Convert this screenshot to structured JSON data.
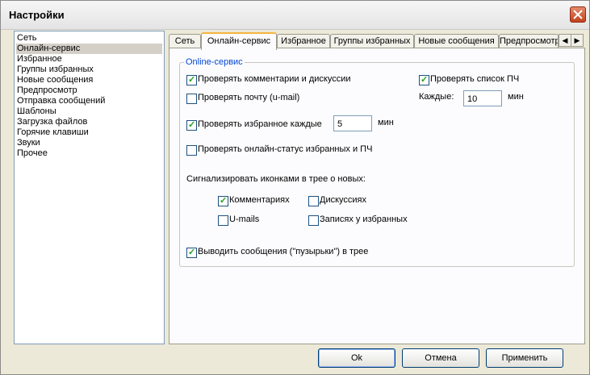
{
  "window": {
    "title": "Настройки"
  },
  "sidebar": {
    "items": [
      "Сеть",
      "Онлайн-сервис",
      "Избранное",
      "Группы избранных",
      "Новые сообщения",
      "Предпросмотр",
      "Отправка сообщений",
      "Шаблоны",
      "Загрузка файлов",
      "Горячие клавиши",
      "Звуки",
      "Прочее"
    ],
    "selected": "Онлайн-сервис"
  },
  "tabs": {
    "items": [
      "Сеть",
      "Онлайн-сервис",
      "Избранное",
      "Группы избранных",
      "Новые сообщения",
      "Предпросмотр"
    ],
    "active": "Онлайн-сервис"
  },
  "group": {
    "title": "Online-сервис"
  },
  "options": {
    "check_comments": {
      "label": "Проверять комментарии и дискуссии",
      "checked": true
    },
    "check_mail": {
      "label": "Проверять почту (u-mail)",
      "checked": false
    },
    "check_favorites": {
      "label": "Проверять избранное каждые",
      "checked": true,
      "value": "5",
      "unit": "мин"
    },
    "check_online_status": {
      "label": "Проверять онлайн-статус избранных и ПЧ",
      "checked": false
    },
    "check_pch": {
      "label": "Проверять список ПЧ",
      "checked": true
    },
    "every_label": "Каждые:",
    "every_value": "10",
    "every_unit": "мин"
  },
  "signal": {
    "heading": "Сигнализировать иконками в трее о новых:",
    "comments": {
      "label": "Комментариях",
      "checked": true
    },
    "discussions": {
      "label": "Дискуссиях",
      "checked": false
    },
    "umails": {
      "label": "U-mails",
      "checked": false
    },
    "fav_posts": {
      "label": "Записях у избранных",
      "checked": false
    }
  },
  "bubbles": {
    "label": "Выводить сообщения (\"пузырьки\") в трее",
    "checked": true
  },
  "buttons": {
    "ok": "Ok",
    "cancel": "Отмена",
    "apply": "Применить"
  }
}
